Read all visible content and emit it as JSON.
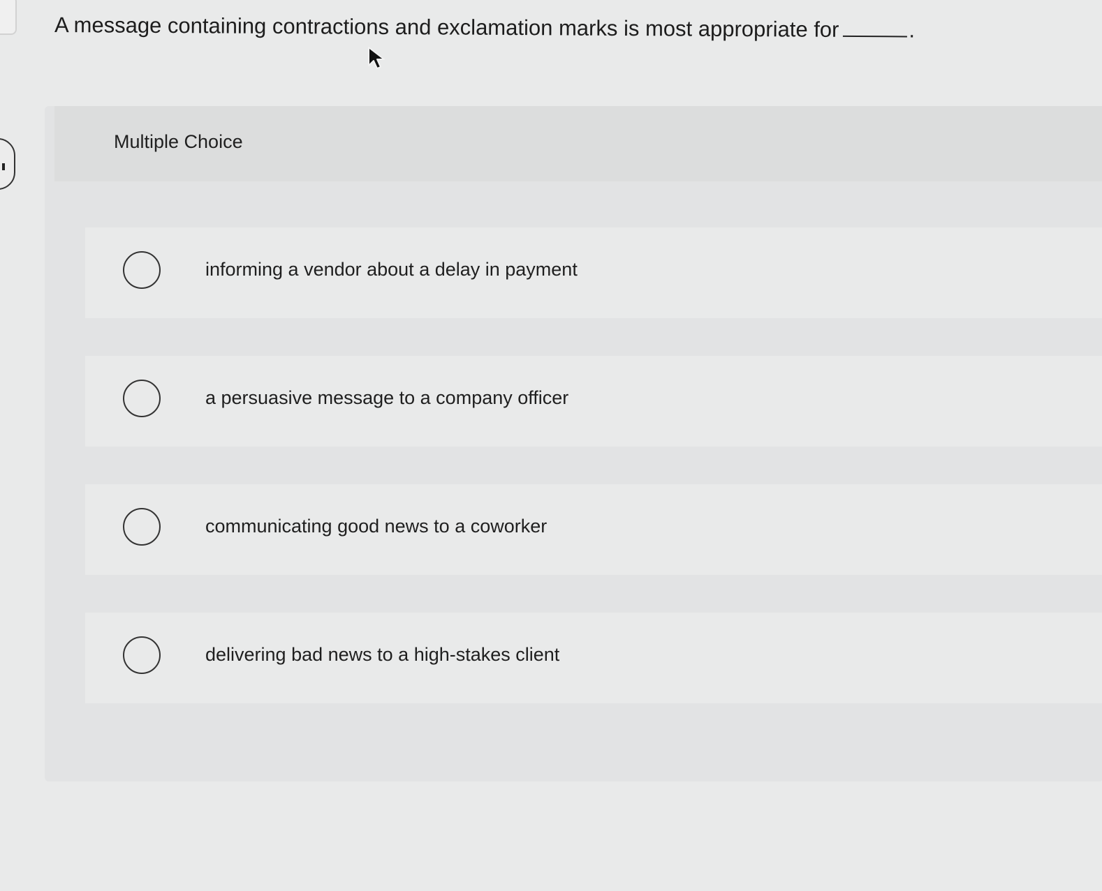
{
  "question": {
    "text": "A message containing contractions and exclamation marks is most appropriate for",
    "period": "."
  },
  "section": {
    "label": "Multiple Choice"
  },
  "options": [
    {
      "label": "informing a vendor about a delay in payment"
    },
    {
      "label": "a persuasive message to a company officer"
    },
    {
      "label": "communicating good news to a coworker"
    },
    {
      "label": "delivering bad news to a high-stakes client"
    }
  ],
  "icons": {
    "cursor": "mouse-pointer-icon",
    "radio": "radio-unselected-icon"
  },
  "colors": {
    "background": "#e9eaea",
    "panel": "#e2e3e4",
    "text": "#1f1f1f"
  }
}
